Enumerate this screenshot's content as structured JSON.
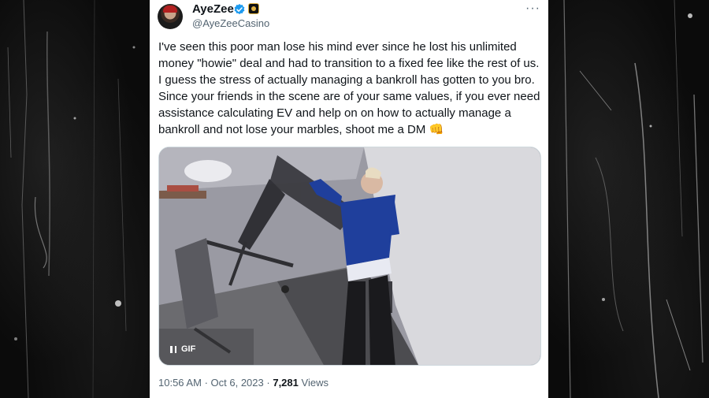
{
  "tweet": {
    "author_name": "AyeZee",
    "author_handle": "@AyeZeeCasino",
    "text": "I've seen this poor man lose his mind ever since he lost his unlimited money \"howie\" deal and had to transition to a fixed fee like the rest of us. I guess the stress of actually managing a bankroll has gotten to you bro. Since your friends in the scene are of your same values, if you ever need assistance calculating EV and help on on how to actually manage a bankroll and not lose your marbles, shoot me a DM 👊",
    "more_menu": "···",
    "media_badge": "GIF",
    "time": "10:56 AM",
    "separator": "·",
    "date": "Oct 6, 2023",
    "views_count": "7,281",
    "views_label": "Views"
  },
  "icons": {
    "verified": "verified-badge-icon",
    "affiliate": "affiliate-badge-icon",
    "pause": "pause-icon",
    "more": "more-options-icon"
  },
  "colors": {
    "verified_blue": "#1d9bf0",
    "text_primary": "#0f1419",
    "text_secondary": "#536471"
  }
}
